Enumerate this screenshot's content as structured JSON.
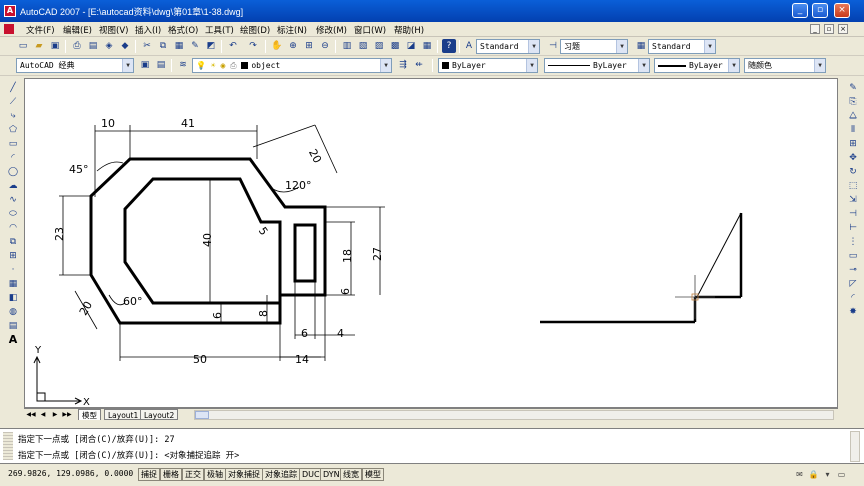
{
  "window": {
    "title": "AutoCAD 2007 - [E:\\autocad资料\\dwg\\第01章\\1-38.dwg]",
    "controls": {
      "minimize": "_",
      "restore": "▫",
      "close": "×"
    }
  },
  "menubar": {
    "items": [
      "文件(F)",
      "编辑(E)",
      "视图(V)",
      "插入(I)",
      "格式(O)",
      "工具(T)",
      "绘图(D)",
      "标注(N)",
      "修改(M)",
      "窗口(W)",
      "帮助(H)"
    ],
    "mdi_controls": [
      "_",
      "▫",
      "×"
    ]
  },
  "toolbar1": {
    "text_style": "Standard",
    "dim_style": "习题",
    "table_style": "Standard"
  },
  "toolbar2": {
    "workspace": "AutoCAD 经典",
    "layer": "object",
    "color": "ByLayer",
    "linetype": "ByLayer",
    "lineweight": "ByLayer",
    "plotstyle": "随颜色"
  },
  "drawing": {
    "dimensions": {
      "d10": "10",
      "d41": "41",
      "d45deg": "45°",
      "d20top": "20",
      "d120deg": "120°",
      "d23": "23",
      "d40": "40",
      "d5": "5",
      "d18": "18",
      "d27": "27",
      "d6right": "6",
      "d60deg": "60°",
      "d20bottom": "20",
      "d6left": "6",
      "d8": "8",
      "d6bottom": "6",
      "d4": "4",
      "d50": "50",
      "d14": "14"
    },
    "ucs": {
      "x": "X",
      "y": "Y"
    }
  },
  "layout_tabs": {
    "nav": [
      "◀◀",
      "◀",
      "▶",
      "▶▶"
    ],
    "tabs": [
      "模型",
      "Layout1",
      "Layout2"
    ],
    "active": "模型"
  },
  "command": {
    "history": "指定下一点或 [闭合(C)/放弃(U)]: 27",
    "current": "指定下一点或 [闭合(C)/放弃(U)]:  <对象捕捉追踪 开>"
  },
  "status": {
    "coordinates": "269.9826, 129.0986, 0.0000",
    "toggles": [
      "捕捉",
      "栅格",
      "正交",
      "极轴",
      "对象捕捉",
      "对象追踪",
      "DUCS",
      "DYN",
      "线宽",
      "模型"
    ]
  }
}
